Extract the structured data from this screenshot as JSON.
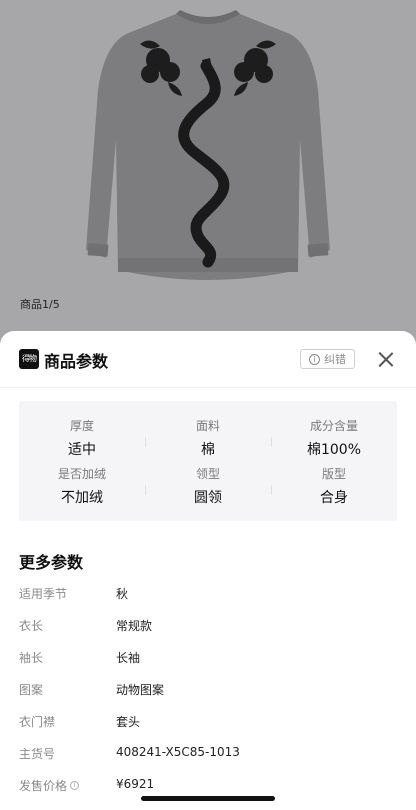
{
  "gallery": {
    "counter": "商品1/5"
  },
  "sheet": {
    "logo_text": "得物",
    "title": "商品参数",
    "report_label": "纠错",
    "info_glyph": "i",
    "icons": {
      "info": "info-icon",
      "close": "close-icon",
      "logo": "app-logo-icon"
    }
  },
  "key_params": [
    {
      "label": "厚度",
      "value": "适中"
    },
    {
      "label": "面料",
      "value": "棉"
    },
    {
      "label": "成分含量",
      "value": "棉100%"
    },
    {
      "label": "是否加绒",
      "value": "不加绒"
    },
    {
      "label": "领型",
      "value": "圆领"
    },
    {
      "label": "版型",
      "value": "合身"
    }
  ],
  "more": {
    "title": "更多参数",
    "rows": [
      {
        "label": "适用季节",
        "value": "秋"
      },
      {
        "label": "衣长",
        "value": "常规款"
      },
      {
        "label": "袖长",
        "value": "长袖"
      },
      {
        "label": "图案",
        "value": "动物图案"
      },
      {
        "label": "衣门襟",
        "value": "套头"
      },
      {
        "label": "主货号",
        "value": "408241-X5C85-1013"
      },
      {
        "label": "发售价格",
        "value": "¥6921"
      }
    ]
  }
}
